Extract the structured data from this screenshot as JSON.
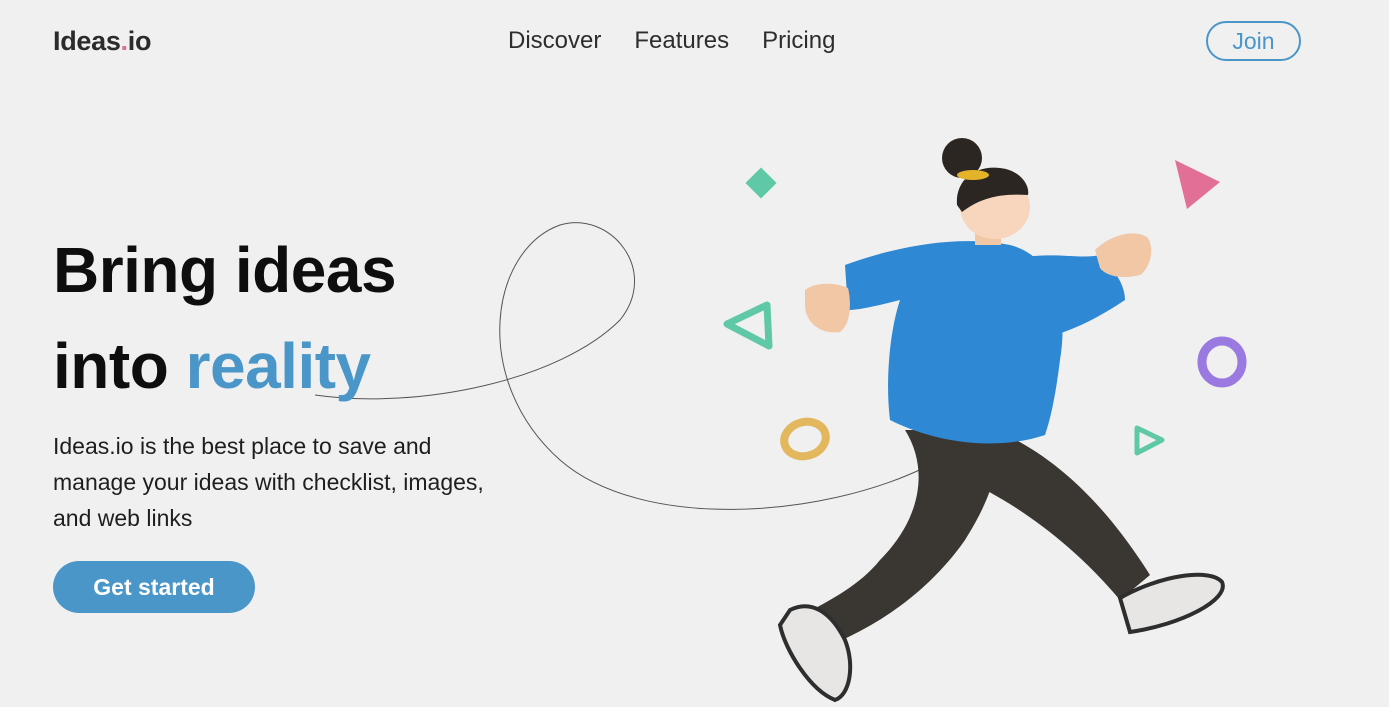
{
  "header": {
    "logo_main": "Ideas",
    "logo_dot": ".",
    "logo_suffix": "io",
    "nav": [
      "Discover",
      "Features",
      "Pricing"
    ],
    "join_label": "Join"
  },
  "hero": {
    "headline_line1": "Bring ideas",
    "headline_line2_prefix": "into ",
    "headline_line2_accent": "reality",
    "description": "Ideas.io is the best place to save and manage your ideas with checklist, images, and web links",
    "cta_label": "Get started"
  },
  "colors": {
    "background": "#f0f0f0",
    "accent": "#4a96c8",
    "logo_dot": "#e0708f"
  }
}
